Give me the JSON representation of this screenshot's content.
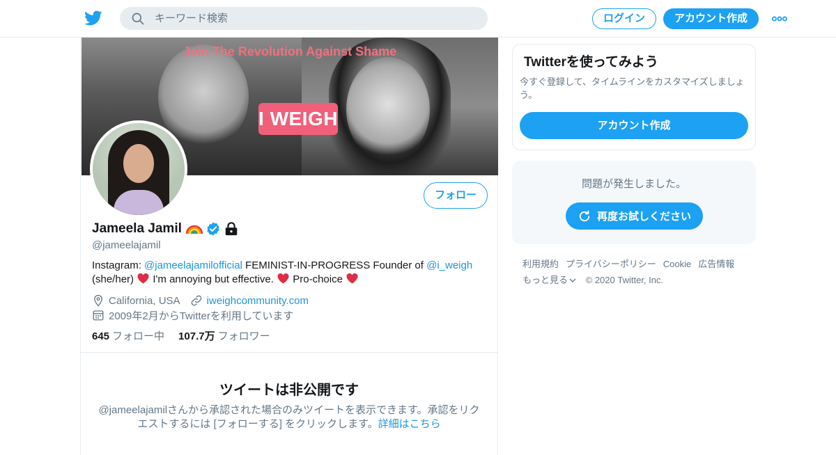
{
  "header": {
    "search_placeholder": "キーワード検索",
    "login_label": "ログイン",
    "signup_label": "アカウント作成",
    "brand_color": "#1da1f2"
  },
  "profile": {
    "banner": {
      "headline": "Join The Revolution Against Shame",
      "badge": "I WEIGH"
    },
    "follow_label": "フォロー",
    "name": "Jameela Jamil",
    "handle": "@jameelajamil",
    "bio": {
      "p1": "Instagram: ",
      "link1": "@jameelajamilofficial",
      "p2": " FEMINIST-IN-PROGRESS Founder of ",
      "link2": "@i_weigh",
      "p3": " (she/her) ",
      "p4": " I'm annoying but effective. ",
      "p5": " Pro-choice "
    },
    "location": "California, USA",
    "website": "iweighcommunity.com",
    "joined": "2009年2月からTwitterを利用しています",
    "following_count": "645",
    "following_label": "フォロー中",
    "followers_count": "107.7万",
    "followers_label": "フォロワー",
    "private_title": "ツイートは非公開です",
    "private_desc": "@jameelajamilさんから承認された場合のみツイートを表示できます。承認をリクエストするには [フォローする] をクリックします。",
    "private_link": "詳細はこちら"
  },
  "sidebar": {
    "signup_card": {
      "title": "Twitterを使ってみよう",
      "desc": "今すぐ登録して、タイムラインをカスタマイズしましょう。",
      "button": "アカウント作成"
    },
    "error_card": {
      "message": "問題が発生しました。",
      "retry_label": "再度お試しください"
    },
    "footer": {
      "links": [
        "利用規約",
        "プライバシーポリシー",
        "Cookie",
        "広告情報"
      ],
      "more": "もっと見る",
      "copyright": "© 2020 Twitter, Inc."
    }
  }
}
